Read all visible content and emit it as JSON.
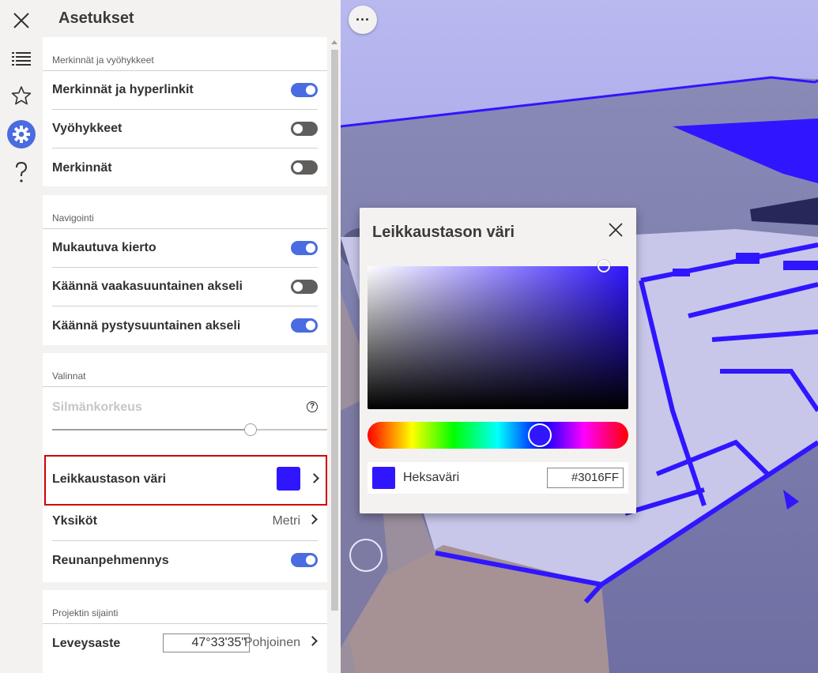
{
  "panel": {
    "title": "Asetukset"
  },
  "rail": {
    "items": [
      {
        "icon": "close-icon"
      },
      {
        "icon": "list-icon"
      },
      {
        "icon": "star-icon"
      },
      {
        "icon": "gear-icon",
        "active": true
      },
      {
        "icon": "help-icon"
      }
    ]
  },
  "sections": {
    "markups": {
      "heading": "Merkinnät ja vyöhykkeet",
      "rows": [
        {
          "label": "Merkinnät ja hyperlinkit",
          "toggle": true
        },
        {
          "label": "Vyöhykkeet",
          "toggle": false
        },
        {
          "label": "Merkinnät",
          "toggle": false
        }
      ]
    },
    "navigation": {
      "heading": "Navigointi",
      "rows": [
        {
          "label": "Mukautuva kierto",
          "toggle": true
        },
        {
          "label": "Käännä vaakasuuntainen akseli",
          "toggle": false
        },
        {
          "label": "Käännä pystysuuntainen akseli",
          "toggle": true
        }
      ]
    },
    "options": {
      "heading": "Valinnat",
      "eye_height_label": "Silmänkorkeus",
      "eye_height_help": "?",
      "eye_height_level": 0.72,
      "section_plane_color_label": "Leikkaustason väri",
      "section_plane_color": "#3016FF",
      "units_label": "Yksiköt",
      "units_value": "Metri",
      "antialias_label": "Reunanpehmennys",
      "antialias_toggle": true
    },
    "location": {
      "heading": "Projektin sijainti",
      "latitude_label": "Leveysaste",
      "latitude_value": "47°33'35\"",
      "latitude_hemisphere": "Pohjoinen"
    }
  },
  "viewport": {
    "more_button": "···"
  },
  "color_picker": {
    "title": "Leikkaustason väri",
    "hex_label": "Heksaväri",
    "hex_value": "#3016FF",
    "hue_color": "#3016FF",
    "hue_fraction": 0.66,
    "saturation_fraction": 0.91,
    "value_fraction": 1.0
  },
  "colors": {
    "accent": "#4a6ce0",
    "selection_highlight": "#d00000",
    "section_plane": "#3016FF"
  }
}
